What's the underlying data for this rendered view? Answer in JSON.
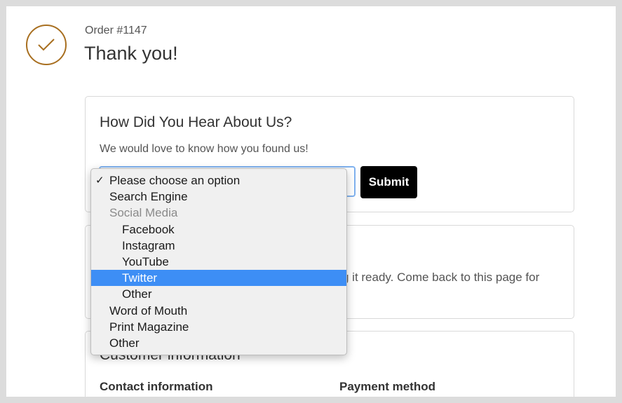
{
  "order": {
    "number_label": "Order #1147",
    "thank_you": "Thank you!"
  },
  "survey": {
    "heading": "How Did You Hear About Us?",
    "description": "We would love to know how you found us!",
    "submit_label": "Submit",
    "options": [
      {
        "label": "Please choose an option",
        "checked": true,
        "indent": false,
        "group": false,
        "highlighted": false
      },
      {
        "label": "Search Engine",
        "checked": false,
        "indent": false,
        "group": false,
        "highlighted": false
      },
      {
        "label": "Social Media",
        "checked": false,
        "indent": false,
        "group": true,
        "highlighted": false
      },
      {
        "label": "Facebook",
        "checked": false,
        "indent": true,
        "group": false,
        "highlighted": false
      },
      {
        "label": "Instagram",
        "checked": false,
        "indent": true,
        "group": false,
        "highlighted": false
      },
      {
        "label": "YouTube",
        "checked": false,
        "indent": true,
        "group": false,
        "highlighted": false
      },
      {
        "label": "Twitter",
        "checked": false,
        "indent": true,
        "group": false,
        "highlighted": true
      },
      {
        "label": "Other",
        "checked": false,
        "indent": true,
        "group": false,
        "highlighted": false
      },
      {
        "label": "Word of Mouth",
        "checked": false,
        "indent": false,
        "group": false,
        "highlighted": false
      },
      {
        "label": "Print Magazine",
        "checked": false,
        "indent": false,
        "group": false,
        "highlighted": false
      },
      {
        "label": "Other",
        "checked": false,
        "indent": false,
        "group": false,
        "highlighted": false
      }
    ]
  },
  "status": {
    "text": "g it ready. Come back to this page for"
  },
  "customer": {
    "heading": "Customer information",
    "contact_label": "Contact information",
    "payment_label": "Payment method"
  },
  "colors": {
    "accent": "#a86f20",
    "highlight": "#3d8ef5",
    "button": "#000000"
  }
}
